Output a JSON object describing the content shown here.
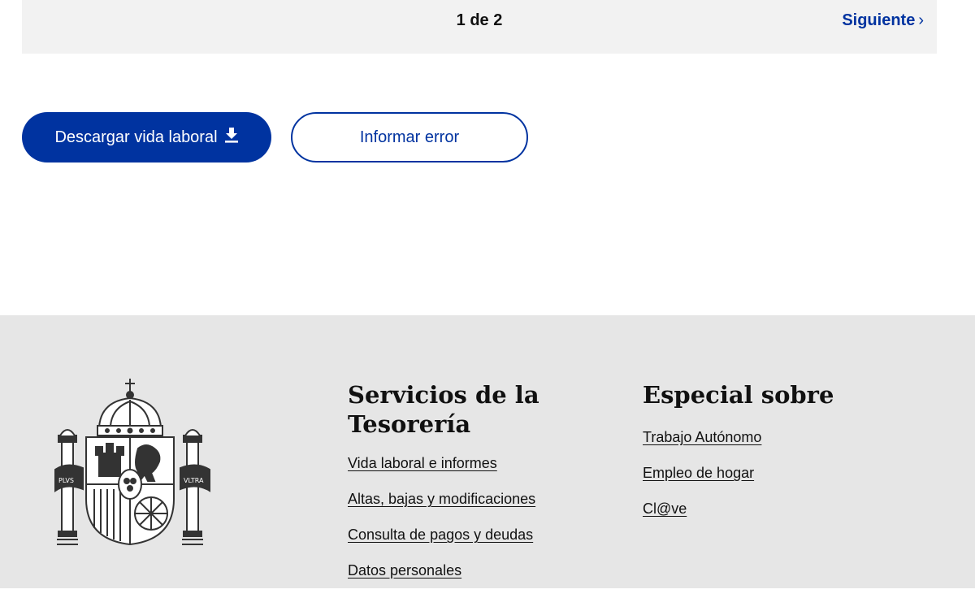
{
  "pagination": {
    "indicator": "1 de 2",
    "next_label": "Siguiente",
    "next_chevron": "›"
  },
  "actions": {
    "download_label": "Descargar vida laboral",
    "report_label": "Informar error"
  },
  "footer": {
    "col1": {
      "title": "Servicios de la Tesorería",
      "links": [
        "Vida laboral e informes",
        "Altas, bajas y modificaciones",
        "Consulta de pagos y deudas",
        "Datos personales"
      ]
    },
    "col2": {
      "title": "Especial sobre",
      "links": [
        "Trabajo Autónomo",
        "Empleo de hogar",
        "Cl@ve"
      ]
    },
    "emblem": {
      "icon": "coat-of-arms-icon",
      "motto_left": "PLVS",
      "motto_right": "VLTRA"
    }
  },
  "colors": {
    "brand_blue": "#0033a0",
    "footer_bg": "#e6e6e6",
    "bar_bg": "#f2f2f2"
  }
}
